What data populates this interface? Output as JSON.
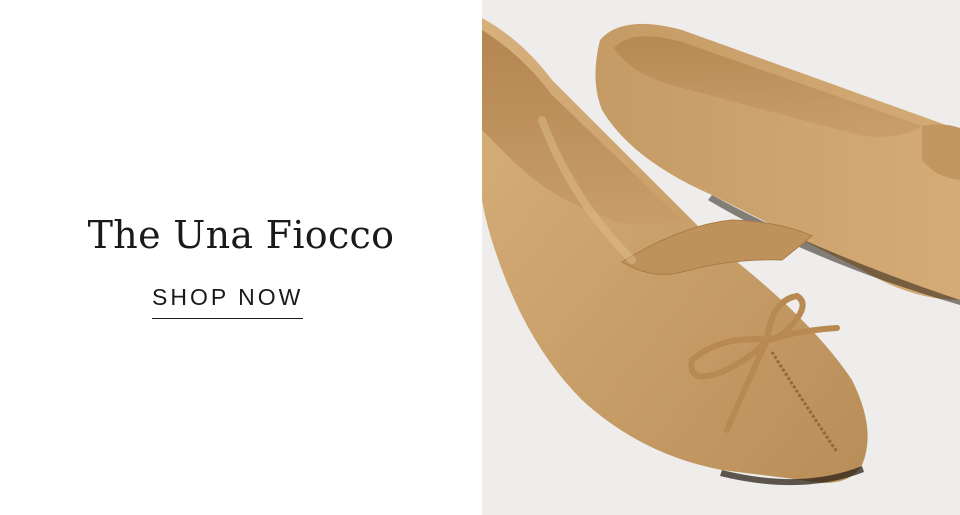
{
  "promo": {
    "title": "The Una Fiocco",
    "cta_label": "SHOP NOW"
  },
  "image": {
    "icon": "ballet-flat-product-photo",
    "leather_color": "#c9a06a",
    "background_color": "#eeedeb"
  }
}
